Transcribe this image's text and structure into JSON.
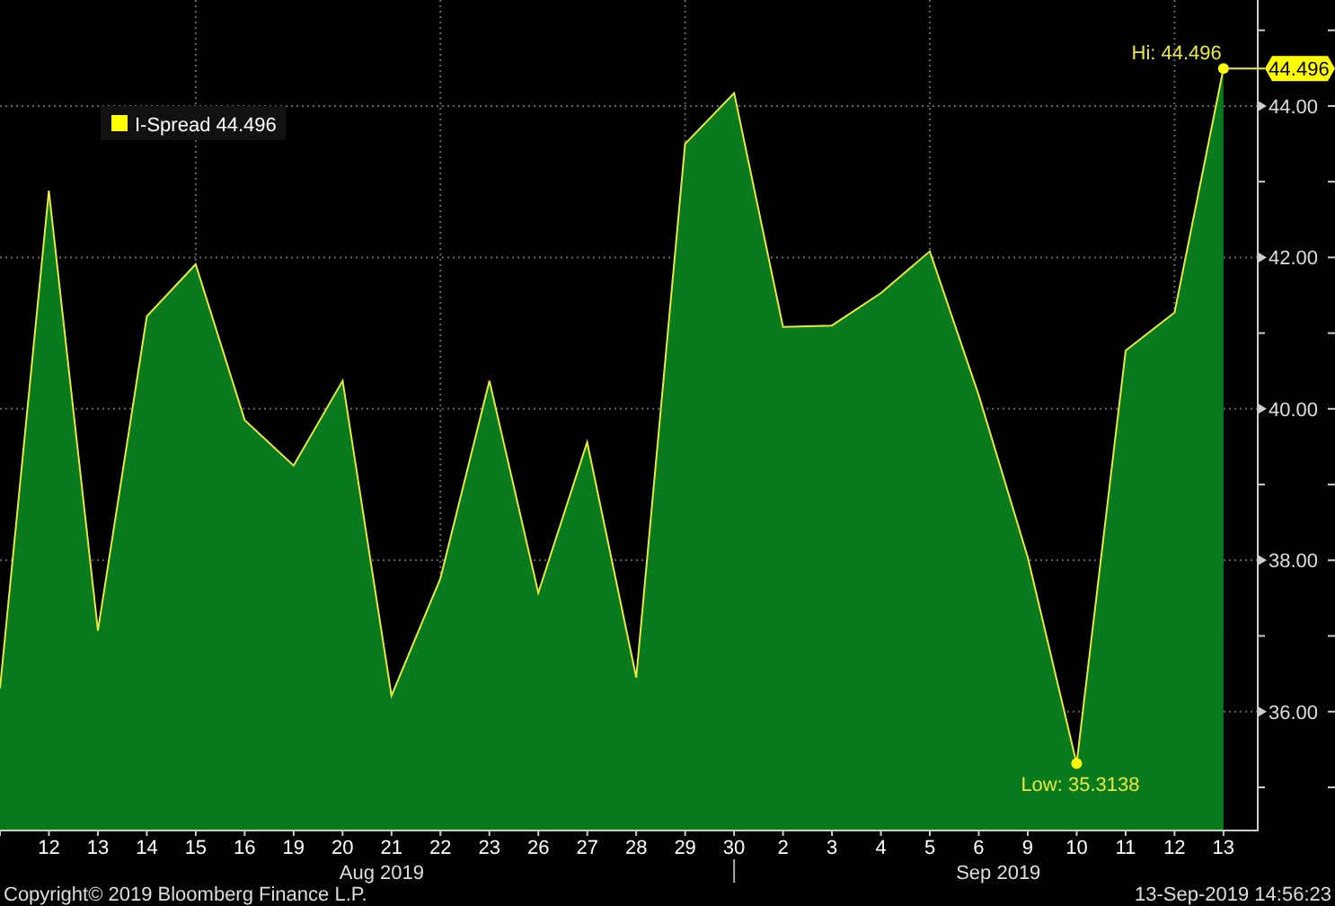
{
  "chart": {
    "legend": {
      "value": "44.496",
      "color": "#ffff00"
    },
    "chart_data": {
      "type": "area",
      "grid": true,
      "categories": [
        null,
        "12",
        "13",
        "14",
        "15",
        "16",
        "19",
        "20",
        "21",
        "22",
        "23",
        "26",
        "27",
        "28",
        "29",
        "30",
        "2",
        "3",
        "4",
        "5",
        "6",
        "9",
        "10",
        "11",
        "12",
        "13"
      ],
      "series": [
        {
          "name": "I-Spread",
          "color": "#0a7a1f",
          "values": [
            36.31,
            42.88,
            37.07,
            41.22,
            41.91,
            39.85,
            39.25,
            40.37,
            36.21,
            37.76,
            40.37,
            37.57,
            39.56,
            36.45,
            43.5,
            44.17,
            41.08,
            41.1,
            41.53,
            42.08,
            40.18,
            38.04,
            35.3138,
            40.77,
            41.27,
            44.496
          ]
        }
      ],
      "ylim": [
        34.43,
        45.4
      ],
      "yticks": [
        {
          "value": 36,
          "label": "36.00"
        },
        {
          "value": 38,
          "label": "38.00"
        },
        {
          "value": 40,
          "label": "40.00"
        },
        {
          "value": 42,
          "label": "42.00"
        },
        {
          "value": 44,
          "label": "44.00"
        }
      ],
      "annotations": [
        "Hi: 44.496",
        "Low: 35.3138",
        "44.496"
      ]
    },
    "periods": [
      {
        "label": "Aug 2019"
      },
      {
        "label": "Sep 2019"
      }
    ]
  },
  "footer": {
    "copyright": "Copyright© 2019 Bloomberg Finance L.P.",
    "timestamp": "13-Sep-2019 14:56:23"
  }
}
